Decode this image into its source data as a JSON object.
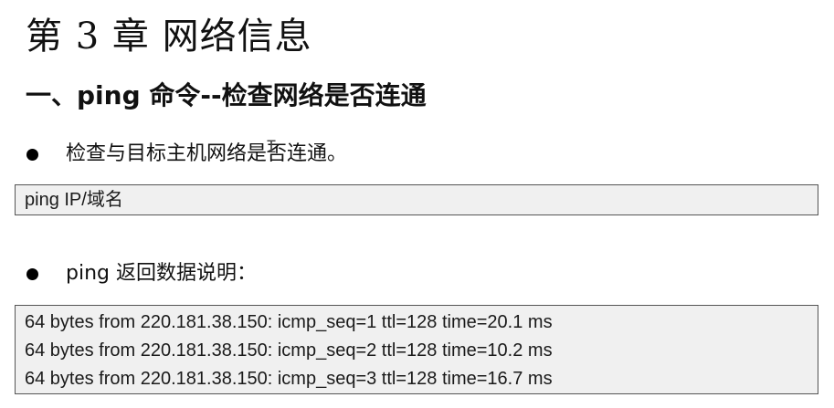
{
  "chapter_title": "第 3 章  网络信息",
  "section_title": "一、ping 命令--检查网络是否连通",
  "bullets": [
    {
      "text": "检查与目标主机网络是否连通。"
    },
    {
      "text": "ping 返回数据说明："
    }
  ],
  "syntax_box": {
    "text": "ping IP/域名"
  },
  "output_box": {
    "lines": [
      "64 bytes from 220.181.38.150: icmp_seq=1 ttl=128 time=20.1 ms",
      "64 bytes from 220.181.38.150: icmp_seq=2 ttl=128 time=10.2 ms",
      "64 bytes from 220.181.38.150: icmp_seq=3 ttl=128 time=16.7 ms"
    ]
  }
}
